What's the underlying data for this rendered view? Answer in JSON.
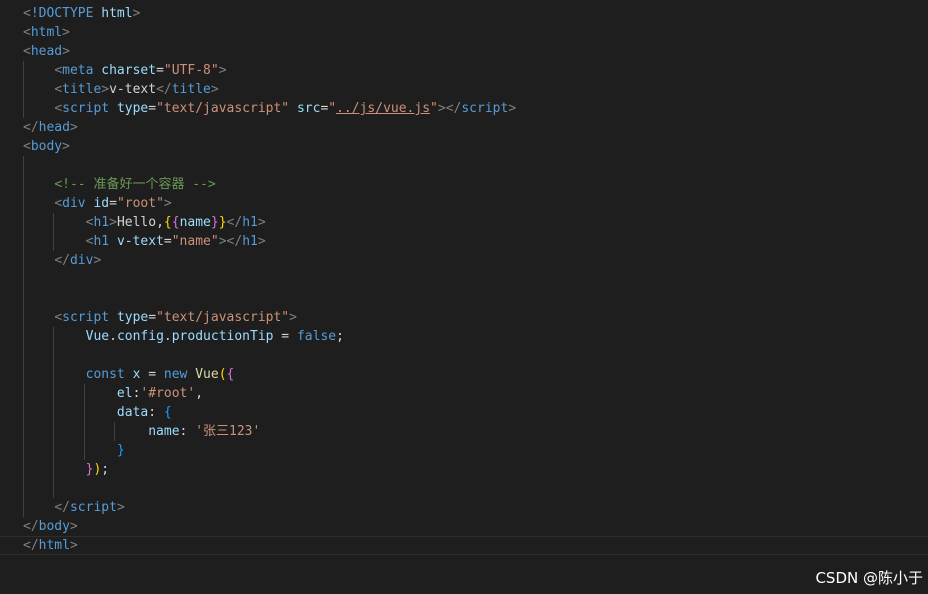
{
  "watermark": "CSDN @陈小于",
  "lines": [
    {
      "indent": 0,
      "tokens": [
        [
          "punc",
          "<"
        ],
        [
          "tag",
          "!DOCTYPE"
        ],
        [
          "text",
          " "
        ],
        [
          "attr",
          "html"
        ],
        [
          "punc",
          ">"
        ]
      ]
    },
    {
      "indent": 0,
      "tokens": [
        [
          "punc",
          "<"
        ],
        [
          "tag",
          "html"
        ],
        [
          "punc",
          ">"
        ]
      ]
    },
    {
      "indent": 0,
      "tokens": [
        [
          "punc",
          "<"
        ],
        [
          "tag",
          "head"
        ],
        [
          "punc",
          ">"
        ]
      ]
    },
    {
      "indent": 1,
      "tokens": [
        [
          "punc",
          "<"
        ],
        [
          "tag",
          "meta"
        ],
        [
          "text",
          " "
        ],
        [
          "attr",
          "charset"
        ],
        [
          "op",
          "="
        ],
        [
          "str",
          "\"UTF-8\""
        ],
        [
          "punc",
          ">"
        ]
      ]
    },
    {
      "indent": 1,
      "tokens": [
        [
          "punc",
          "<"
        ],
        [
          "tag",
          "title"
        ],
        [
          "punc",
          ">"
        ],
        [
          "text",
          "v-text"
        ],
        [
          "punc",
          "</"
        ],
        [
          "tag",
          "title"
        ],
        [
          "punc",
          ">"
        ]
      ]
    },
    {
      "indent": 1,
      "tokens": [
        [
          "punc",
          "<"
        ],
        [
          "tag",
          "script"
        ],
        [
          "text",
          " "
        ],
        [
          "attr",
          "type"
        ],
        [
          "op",
          "="
        ],
        [
          "str",
          "\"text/javascript\""
        ],
        [
          "text",
          " "
        ],
        [
          "attr",
          "src"
        ],
        [
          "op",
          "="
        ],
        [
          "str",
          "\""
        ],
        [
          "strlink",
          "../js/vue.js"
        ],
        [
          "str",
          "\""
        ],
        [
          "punc",
          ">"
        ],
        [
          "punc",
          "</"
        ],
        [
          "tag",
          "script"
        ],
        [
          "punc",
          ">"
        ]
      ]
    },
    {
      "indent": 0,
      "tokens": [
        [
          "punc",
          "</"
        ],
        [
          "tag",
          "head"
        ],
        [
          "punc",
          ">"
        ]
      ]
    },
    {
      "indent": 0,
      "tokens": [
        [
          "punc",
          "<"
        ],
        [
          "tag",
          "body"
        ],
        [
          "punc",
          ">"
        ]
      ]
    },
    {
      "indent": 1,
      "tokens": []
    },
    {
      "indent": 1,
      "tokens": [
        [
          "comment",
          "<!-- 准备好一个容器 -->"
        ]
      ]
    },
    {
      "indent": 1,
      "tokens": [
        [
          "punc",
          "<"
        ],
        [
          "tag",
          "div"
        ],
        [
          "text",
          " "
        ],
        [
          "attr",
          "id"
        ],
        [
          "op",
          "="
        ],
        [
          "str",
          "\"root\""
        ],
        [
          "punc",
          ">"
        ]
      ]
    },
    {
      "indent": 2,
      "tokens": [
        [
          "punc",
          "<"
        ],
        [
          "tag",
          "h1"
        ],
        [
          "punc",
          ">"
        ],
        [
          "text",
          "Hello,"
        ],
        [
          "br1",
          "{"
        ],
        [
          "br2",
          "{"
        ],
        [
          "var",
          "name"
        ],
        [
          "br2",
          "}"
        ],
        [
          "br1",
          "}"
        ],
        [
          "punc",
          "</"
        ],
        [
          "tag",
          "h1"
        ],
        [
          "punc",
          ">"
        ]
      ]
    },
    {
      "indent": 2,
      "tokens": [
        [
          "punc",
          "<"
        ],
        [
          "tag",
          "h1"
        ],
        [
          "text",
          " "
        ],
        [
          "attr",
          "v-text"
        ],
        [
          "op",
          "="
        ],
        [
          "str",
          "\"name\""
        ],
        [
          "punc",
          "></"
        ],
        [
          "tag",
          "h1"
        ],
        [
          "punc",
          ">"
        ]
      ]
    },
    {
      "indent": 1,
      "tokens": [
        [
          "punc",
          "</"
        ],
        [
          "tag",
          "div"
        ],
        [
          "punc",
          ">"
        ]
      ]
    },
    {
      "indent": 1,
      "tokens": []
    },
    {
      "indent": 1,
      "tokens": []
    },
    {
      "indent": 1,
      "tokens": [
        [
          "punc",
          "<"
        ],
        [
          "tag",
          "script"
        ],
        [
          "text",
          " "
        ],
        [
          "attr",
          "type"
        ],
        [
          "op",
          "="
        ],
        [
          "str",
          "\"text/javascript\""
        ],
        [
          "punc",
          ">"
        ]
      ]
    },
    {
      "indent": 2,
      "tokens": [
        [
          "var",
          "Vue"
        ],
        [
          "op",
          "."
        ],
        [
          "var",
          "config"
        ],
        [
          "op",
          "."
        ],
        [
          "var",
          "productionTip"
        ],
        [
          "op",
          " = "
        ],
        [
          "kw",
          "false"
        ],
        [
          "op",
          ";"
        ]
      ]
    },
    {
      "indent": 2,
      "tokens": []
    },
    {
      "indent": 2,
      "tokens": [
        [
          "kw",
          "const"
        ],
        [
          "text",
          " "
        ],
        [
          "var",
          "x"
        ],
        [
          "op",
          " = "
        ],
        [
          "kw",
          "new"
        ],
        [
          "text",
          " "
        ],
        [
          "fn",
          "Vue"
        ],
        [
          "br1",
          "("
        ],
        [
          "br2",
          "{"
        ]
      ]
    },
    {
      "indent": 3,
      "tokens": [
        [
          "var",
          "el"
        ],
        [
          "op",
          ":"
        ],
        [
          "str",
          "'#root'"
        ],
        [
          "op",
          ","
        ]
      ]
    },
    {
      "indent": 3,
      "tokens": [
        [
          "var",
          "data"
        ],
        [
          "op",
          ": "
        ],
        [
          "br3",
          "{"
        ]
      ]
    },
    {
      "indent": 4,
      "tokens": [
        [
          "var",
          "name"
        ],
        [
          "op",
          ": "
        ],
        [
          "str",
          "'张三123'"
        ]
      ]
    },
    {
      "indent": 3,
      "tokens": [
        [
          "br3",
          "}"
        ]
      ]
    },
    {
      "indent": 2,
      "tokens": [
        [
          "br2",
          "}"
        ],
        [
          "br1",
          ")"
        ],
        [
          "op",
          ";"
        ]
      ]
    },
    {
      "indent": 2,
      "tokens": []
    },
    {
      "indent": 1,
      "tokens": [
        [
          "punc",
          "</"
        ],
        [
          "tag",
          "script"
        ],
        [
          "punc",
          ">"
        ]
      ]
    },
    {
      "indent": 0,
      "tokens": [
        [
          "punc",
          "</"
        ],
        [
          "tag",
          "body"
        ],
        [
          "punc",
          ">"
        ]
      ]
    },
    {
      "indent": 0,
      "current": true,
      "tokens": [
        [
          "punc",
          "</"
        ],
        [
          "tag",
          "html"
        ],
        [
          "punc",
          ">"
        ]
      ]
    }
  ]
}
